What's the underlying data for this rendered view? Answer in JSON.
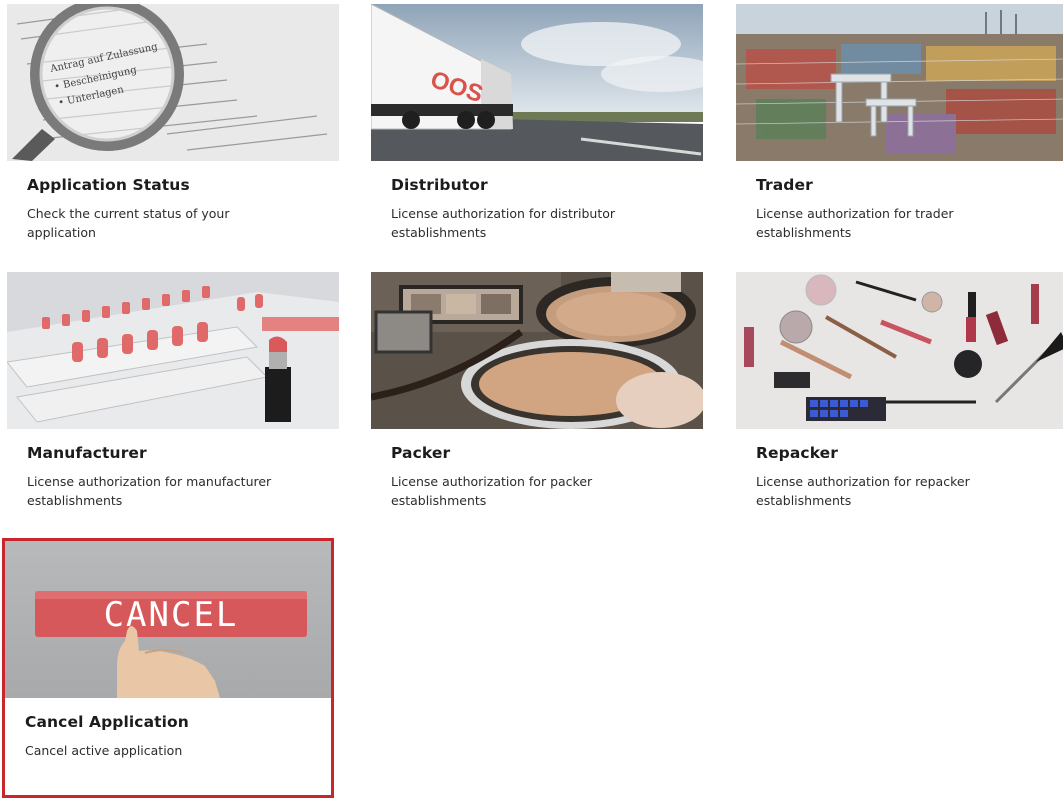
{
  "cards": [
    {
      "title": "Application Status",
      "description": "Check the current status of your application",
      "image": "magnifier-document"
    },
    {
      "title": "Distributor",
      "description": "License authorization for distributor establishments",
      "image": "truck-highway"
    },
    {
      "title": "Trader",
      "description": "License authorization for trader establishments",
      "image": "container-port"
    },
    {
      "title": "Manufacturer",
      "description": "License authorization for manufacturer establishments",
      "image": "lipstick-production"
    },
    {
      "title": "Packer",
      "description": "License authorization for packer establishments",
      "image": "compact-powder"
    },
    {
      "title": "Repacker",
      "description": "License authorization for repacker establishments",
      "image": "cosmetics-flatlay"
    },
    {
      "title": "Cancel Application",
      "description": "Cancel active application",
      "image": "cancel-button-press",
      "image_text": "CANCEL",
      "highlight_color": "#c8262d"
    }
  ]
}
